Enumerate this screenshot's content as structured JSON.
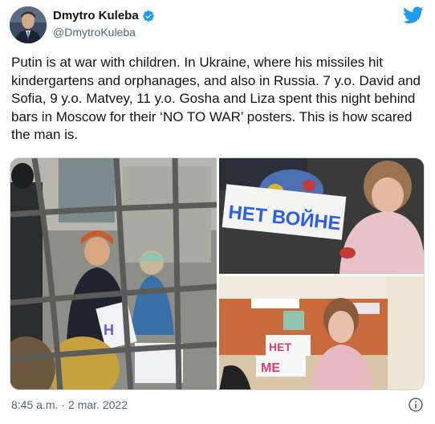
{
  "author": {
    "name": "Dmytro Kuleba",
    "handle": "@DmytroKuleba"
  },
  "tweet": {
    "text": "Putin is at war with children. In Ukraine, where his missiles hit kindergartens and orphanages, and also in Russia. 7 y.o. David and Sofia, 9 y.o. Matvey, 11 y.o. Gosha and Liza spent this night behind bars in Moscow for their ‘NO TO WAR’ posters. This is how scared the man is.",
    "time": "8:45 a.m.",
    "separator": "·",
    "date": "2 mar. 2022"
  },
  "media": {
    "poster_top": "НЕТ ВОЙНЕ",
    "poster_bottom_line1": "НЕТ",
    "poster_bottom_line2": "МЕ",
    "poster_left": "Н"
  },
  "icons": {
    "verified": "verified-badge-icon",
    "twitter": "twitter-bird-icon",
    "info": "info-icon"
  },
  "colors": {
    "brand": "#1d9bf0",
    "text": "#0f1419",
    "muted": "#536471"
  }
}
